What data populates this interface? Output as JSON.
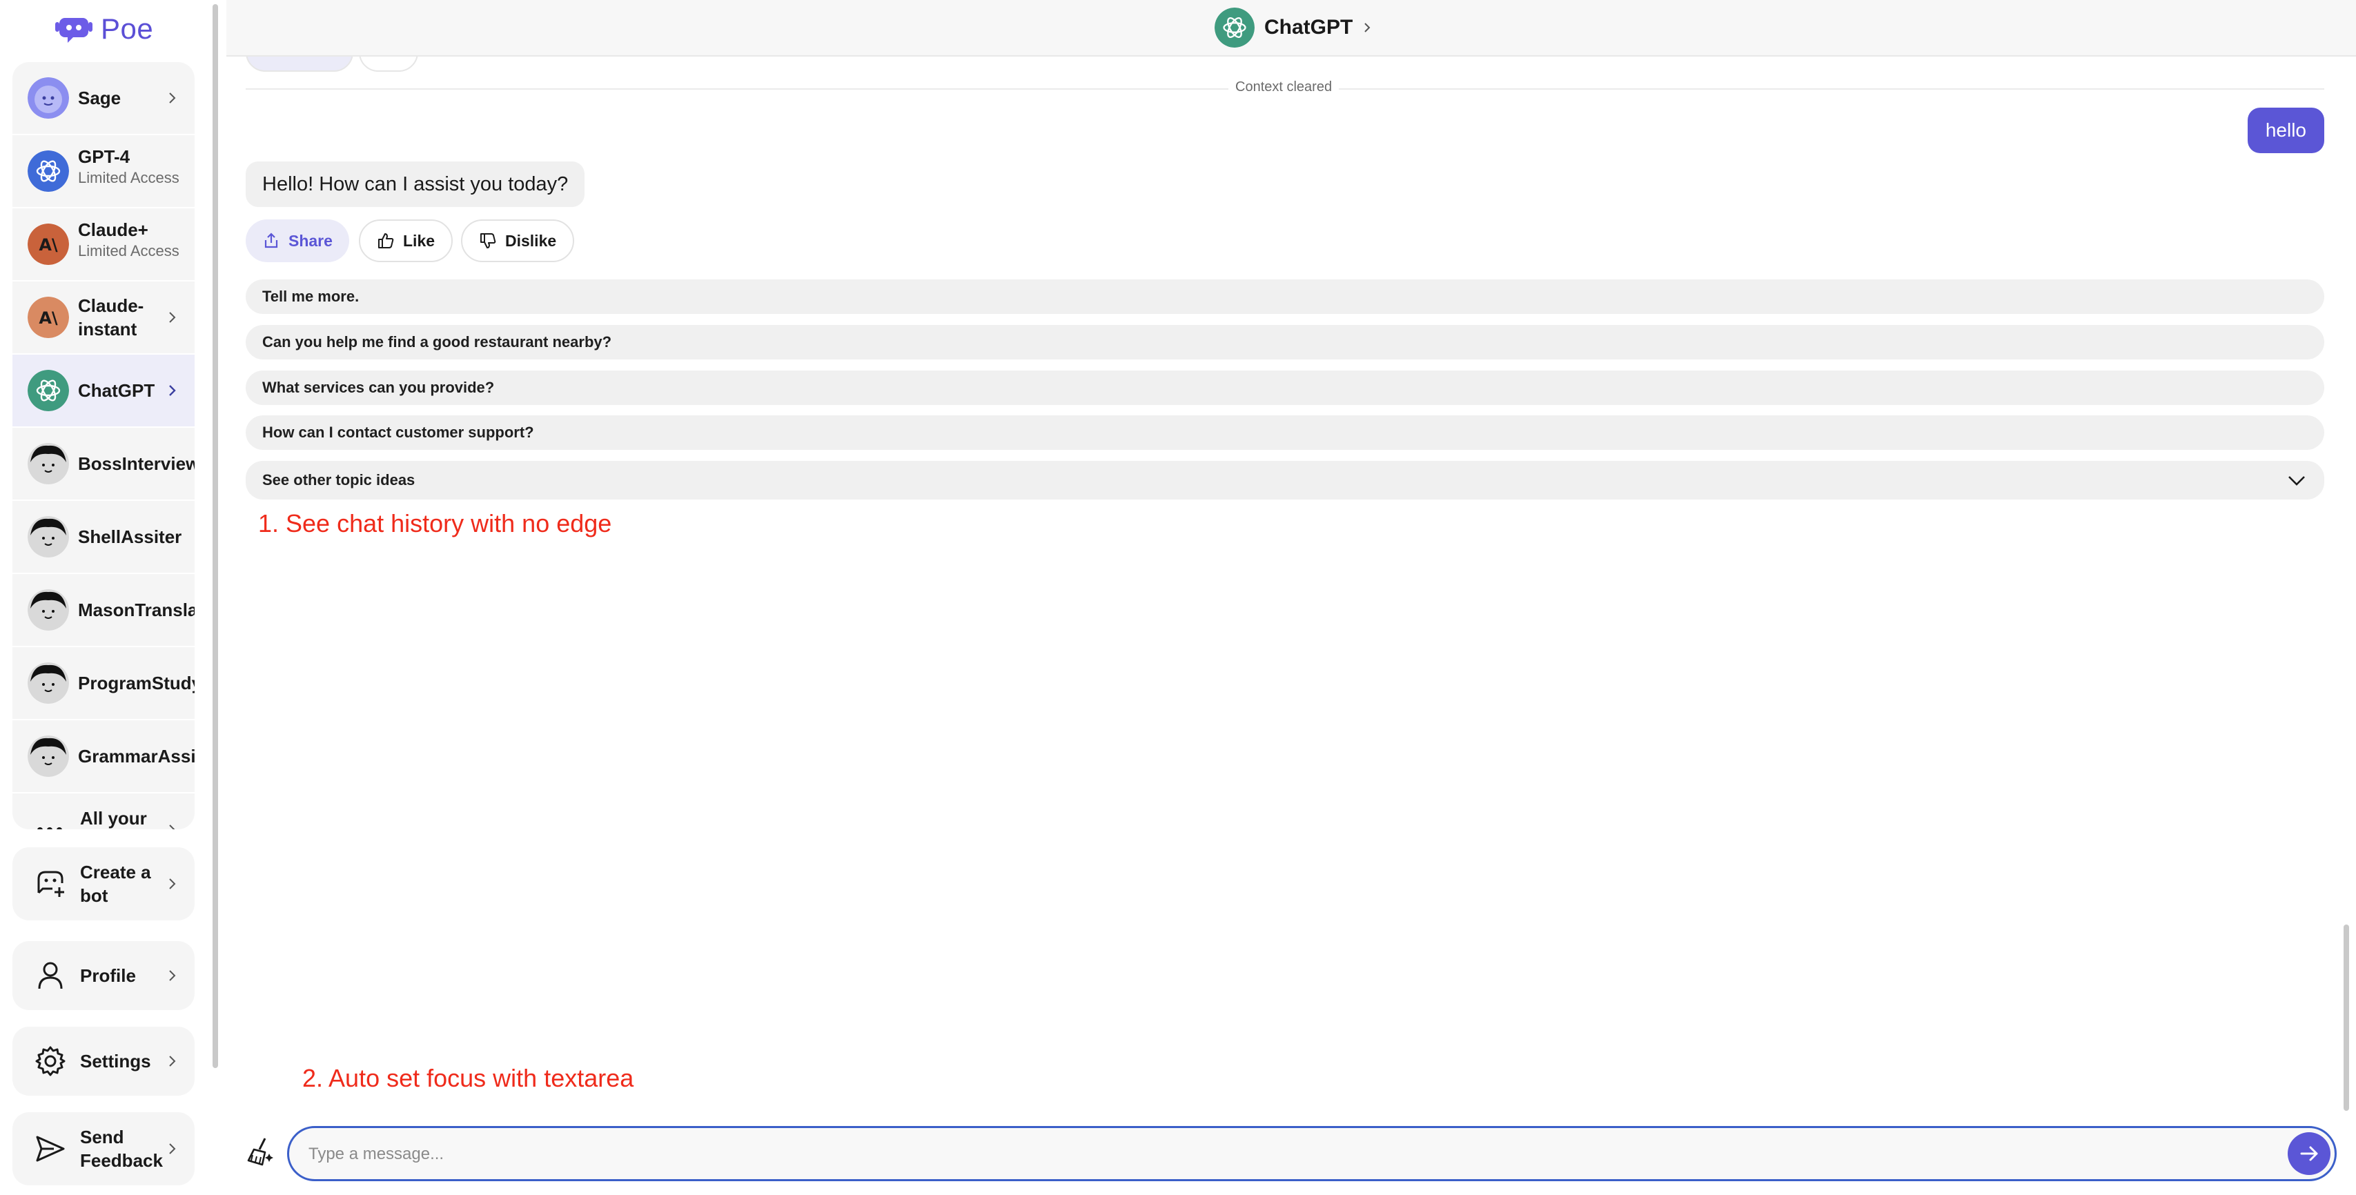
{
  "app": {
    "logo_text": "Poe"
  },
  "sidebar": {
    "bots": [
      {
        "name": "Sage",
        "sub": "",
        "avatar": "sage-avatar",
        "color": "#8b8ef0"
      },
      {
        "name": "GPT-4",
        "sub": "Limited Access",
        "avatar": "openai-avatar",
        "color": "#3f6bd8"
      },
      {
        "name": "Claude+",
        "sub": "Limited Access",
        "avatar": "anthropic-avatar",
        "color": "#c9623b"
      },
      {
        "name": "Claude-instant",
        "sub": "",
        "avatar": "anthropic-avatar",
        "color": "#d98a62"
      },
      {
        "name": "ChatGPT",
        "sub": "",
        "avatar": "openai-avatar",
        "color": "#3f9b7f"
      },
      {
        "name": "BossInterview",
        "sub": "",
        "avatar": "default-face-avatar"
      },
      {
        "name": "ShellAssiter",
        "sub": "",
        "avatar": "default-face-avatar"
      },
      {
        "name": "MasonTranslat",
        "sub": "",
        "avatar": "default-face-avatar"
      },
      {
        "name": "ProgramStudy",
        "sub": "",
        "avatar": "default-face-avatar"
      },
      {
        "name": "GrammarAssis",
        "sub": "",
        "avatar": "default-face-avatar"
      }
    ],
    "all_bots_label": "All your bots",
    "create_bot_label": "Create a bot",
    "profile_label": "Profile",
    "settings_label": "Settings",
    "feedback_label": "Send Feedback"
  },
  "header": {
    "bot_name": "ChatGPT"
  },
  "chat": {
    "context_cleared": "Context cleared",
    "user_message": "hello",
    "bot_message": "Hello! How can I assist you today?",
    "actions": {
      "share": "Share",
      "like": "Like",
      "dislike": "Dislike"
    },
    "suggestions": [
      "Tell me more.",
      "Can you help me find a good restaurant nearby?",
      "What services can you provide?",
      "How can I contact customer support?"
    ],
    "other_topics": "See other topic ideas"
  },
  "annotations": {
    "note1": "1. See chat history with no edge",
    "note2": "2. Auto set focus with textarea"
  },
  "composer": {
    "placeholder": "Type a message...",
    "value": ""
  },
  "colors": {
    "accent": "#5b56d6",
    "annotation": "#ef2b1b",
    "focus_border": "#3b5fc9"
  }
}
